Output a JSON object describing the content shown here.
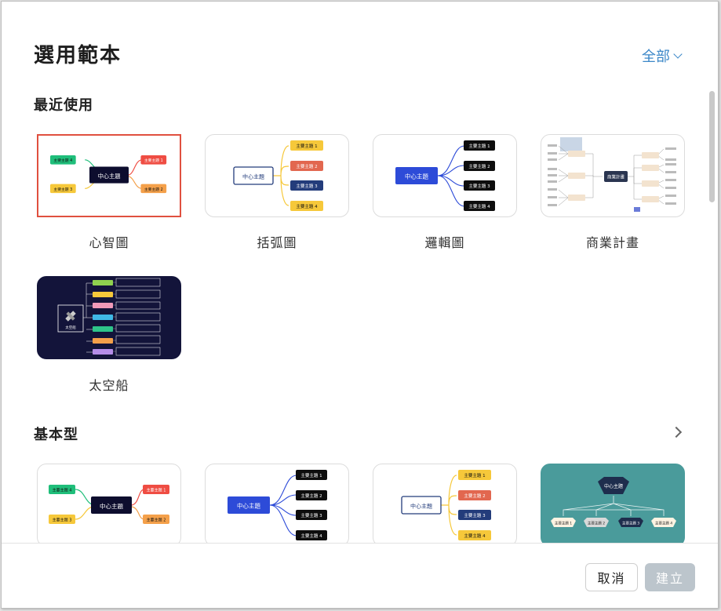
{
  "dialog": {
    "title": "選用範本",
    "filter_label": "全部"
  },
  "sections": {
    "recent": {
      "title": "最近使用",
      "cards": [
        {
          "label": "心智圖"
        },
        {
          "label": "括弧圖"
        },
        {
          "label": "邏輯圖"
        },
        {
          "label": "商業計畫"
        },
        {
          "label": "太空船"
        }
      ]
    },
    "basic": {
      "title": "基本型"
    }
  },
  "thumb_text": {
    "center": "中心主題",
    "t1": "主要主題 1",
    "t2": "主要主題 2",
    "t3": "主要主題 3",
    "t4": "主要主題 4",
    "biz_center": "商業計畫",
    "ship_center": "太空船"
  },
  "footer": {
    "cancel_label": "取消",
    "create_label": "建立"
  },
  "colors": {
    "accent": "#3b87c8",
    "selected_border": "#e0503f",
    "green": "#1fbe7a",
    "red": "#ef4d43",
    "yellow": "#f6c83a",
    "orange": "#f4a04a",
    "navy": "#0d0d2e",
    "blue": "#2d4bd8",
    "dark_navy_btn": "#233c7b",
    "teal": "#4a9b9b"
  }
}
